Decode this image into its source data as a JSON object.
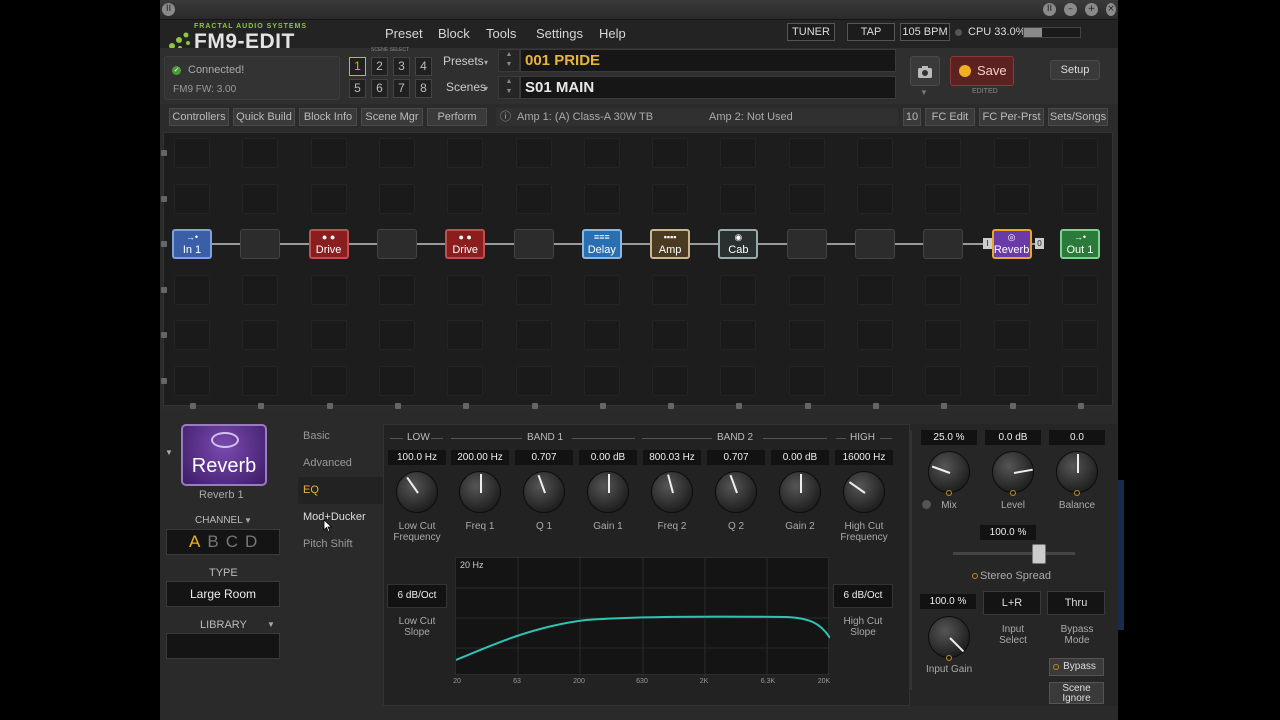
{
  "app": {
    "logo_sub": "FRACTAL AUDIO SYSTEMS",
    "logo_main": "FM9-EDIT"
  },
  "menu": [
    "Preset",
    "Block",
    "Tools",
    "Settings",
    "Help"
  ],
  "top_buttons": {
    "tuner": "TUNER",
    "tap": "TAP",
    "bpm": "105 BPM",
    "cpu": "CPU 33.0%",
    "cpu_fraction": 0.33
  },
  "status": {
    "connected": "Connected!",
    "firmware": "FM9 FW: 3.00"
  },
  "scene_select": {
    "label": "SCENE SELECT",
    "buttons": [
      "1",
      "2",
      "3",
      "4",
      "5",
      "6",
      "7",
      "8"
    ],
    "active": "1"
  },
  "presets": {
    "label": "Presets",
    "value": "001  PRIDE"
  },
  "scenes": {
    "label": "Scenes",
    "value": "S01  MAIN"
  },
  "save": {
    "label": "Save",
    "edited": "EDITED"
  },
  "setup": "Setup",
  "toolbar": {
    "left": [
      "Controllers",
      "Quick Build",
      "Block Info",
      "Scene Mgr",
      "Perform"
    ],
    "info_icon": "ⓘ",
    "amp1": "Amp 1: (A) Class-A 30W TB",
    "amp2": "Amp 2: Not Used",
    "right": [
      "10",
      "FC Edit",
      "FC Per-Prst",
      "Sets/Songs"
    ]
  },
  "blocks": [
    {
      "label": "In 1",
      "icon": "→•",
      "color": "#3a5fa8",
      "border": "#7fa0d8"
    },
    {
      "label": "",
      "empty": true
    },
    {
      "label": "Drive",
      "icon": "● ●",
      "color": "#8a1e1e",
      "border": "#c05050"
    },
    {
      "label": "",
      "empty": true
    },
    {
      "label": "Drive",
      "icon": "● ●",
      "color": "#8a1e1e",
      "border": "#c05050"
    },
    {
      "label": "",
      "empty": true
    },
    {
      "label": "Delay",
      "icon": "≡≡≡",
      "color": "#2a6fb0",
      "border": "#8ab8e0"
    },
    {
      "label": "Amp",
      "icon": "▪▪▪▪",
      "color": "#4a3a22",
      "border": "#c8b890"
    },
    {
      "label": "Cab",
      "icon": "◉",
      "color": "#2a3030",
      "border": "#9aa"
    },
    {
      "label": "",
      "empty": true
    },
    {
      "label": "",
      "empty": true
    },
    {
      "label": "",
      "empty": true
    },
    {
      "label": "Reverb",
      "icon": "◎",
      "color": "#6a3aa8",
      "border": "#e6a826"
    },
    {
      "label": "Out 1",
      "icon": "→•",
      "color": "#2a7a3a",
      "border": "#80d090"
    }
  ],
  "reverb_tags": {
    "in": "I",
    "out": "0"
  },
  "block_panel": {
    "icon_label": "Reverb",
    "name": "Reverb 1",
    "channel_label": "CHANNEL",
    "channels": [
      "A",
      "B",
      "C",
      "D"
    ],
    "active_channel": "A",
    "type_label": "TYPE",
    "type_value": "Large Room",
    "library_label": "LIBRARY"
  },
  "tabs": [
    "Basic",
    "Advanced",
    "EQ",
    "Mod+Ducker",
    "Pitch Shift"
  ],
  "selected_tab": "EQ",
  "eq": {
    "headers": [
      "LOW",
      "BAND 1",
      "BAND 2",
      "HIGH"
    ],
    "values": [
      "100.0 Hz",
      "200.00 Hz",
      "0.707",
      "0.00 dB",
      "800.03 Hz",
      "0.707",
      "0.00 dB",
      "16000 Hz"
    ],
    "labels": [
      "Low Cut\nFrequency",
      "Freq 1",
      "Q 1",
      "Gain 1",
      "Freq 2",
      "Q 2",
      "Gain 2",
      "High Cut\nFrequency"
    ],
    "low_slope": "6 dB/Oct",
    "low_slope_label": "Low Cut\nSlope",
    "high_slope": "6 dB/Oct",
    "high_slope_label": "High Cut\nSlope",
    "plot_label": "20 Hz",
    "x_ticks": [
      "20",
      "63",
      "200",
      "630",
      "2K",
      "6.3K",
      "20K"
    ]
  },
  "mix": {
    "values": [
      "25.0 %",
      "0.0 dB",
      "0.0"
    ],
    "labels": [
      "Mix",
      "Level",
      "Balance"
    ],
    "spread_value": "100.0 %",
    "spread_label": "Stereo Spread",
    "input_gain_value": "100.0 %",
    "input_gain_label": "Input Gain",
    "input_select_value": "L+R",
    "input_select_label": "Input\nSelect",
    "bypass_mode_value": "Thru",
    "bypass_mode_label": "Bypass\nMode",
    "bypass": "Bypass",
    "scene_ignore": "Scene\nIgnore"
  }
}
